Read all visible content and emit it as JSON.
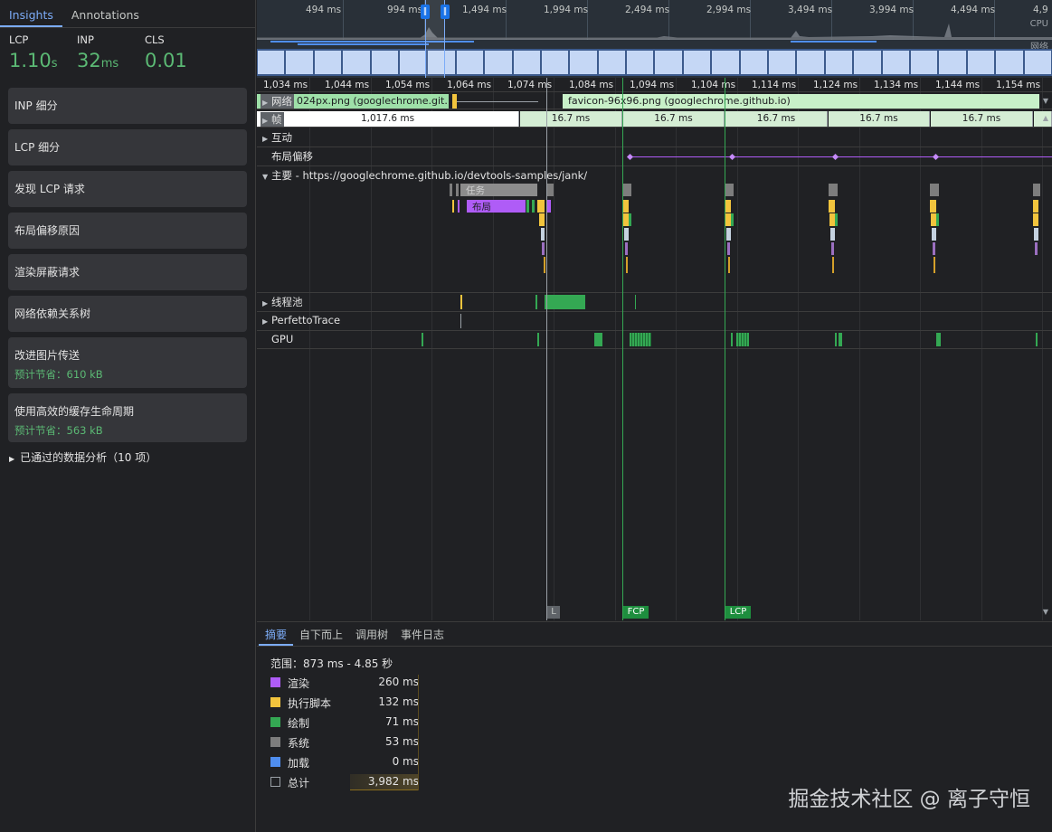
{
  "sidebar": {
    "tabs": [
      {
        "label": "Insights"
      },
      {
        "label": "Annotations"
      }
    ],
    "metrics": [
      {
        "label": "LCP",
        "value": "1.10",
        "unit": "s"
      },
      {
        "label": "INP",
        "value": "32",
        "unit": "ms"
      },
      {
        "label": "CLS",
        "value": "0.01",
        "unit": ""
      }
    ],
    "insights": [
      {
        "title": "INP 细分"
      },
      {
        "title": "LCP 细分"
      },
      {
        "title": "发现 LCP 请求"
      },
      {
        "title": "布局偏移原因"
      },
      {
        "title": "渲染屏蔽请求"
      },
      {
        "title": "网络依赖关系树"
      },
      {
        "title": "改进图片传送",
        "saving": "预计节省：610 kB"
      },
      {
        "title": "使用高效的缓存生命周期",
        "saving": "预计节省：563 kB"
      }
    ],
    "passed": "已通过的数据分析（10 项）"
  },
  "overview": {
    "ticks": [
      "494 ms",
      "994 ms",
      "1,494 ms",
      "1,994 ms",
      "2,494 ms",
      "2,994 ms",
      "3,494 ms",
      "3,994 ms",
      "4,494 ms",
      "4,9"
    ],
    "cpu_label": "CPU",
    "net_label": "网络"
  },
  "timeline": {
    "ruler": [
      "1,034 ms",
      "1,044 ms",
      "1,054 ms",
      "1,064 ms",
      "1,074 ms",
      "1,084 ms",
      "1,094 ms",
      "1,104 ms",
      "1,114 ms",
      "1,124 ms",
      "1,134 ms",
      "1,144 ms",
      "1,154 ms"
    ],
    "network": {
      "label": "网络",
      "request1": "024px.png (googlechrome.git...",
      "request2": "favicon-96x96.png (googlechrome.github.io)"
    },
    "frames": {
      "label": "帧",
      "first": "1,017.6 ms",
      "items": [
        "16.7 ms",
        "16.7 ms",
        "16.7 ms",
        "16.7 ms",
        "16.7 ms"
      ]
    },
    "tracks": {
      "interactions": "互动",
      "layout_shifts": "布局偏移",
      "main": "主要 - https://googlechrome.github.io/devtools-samples/jank/",
      "thread_pool": "线程池",
      "perfetto": "PerfettoTrace",
      "gpu": "GPU"
    },
    "task_label": "任务",
    "layout_label": "布局",
    "markers": {
      "l": "L",
      "fcp": "FCP",
      "lcp": "LCP"
    }
  },
  "bottom": {
    "tabs": [
      {
        "label": "摘要"
      },
      {
        "label": "自下而上"
      },
      {
        "label": "调用树"
      },
      {
        "label": "事件日志"
      }
    ],
    "range": "范围：873 ms - 4.85 秒",
    "categories": [
      {
        "name": "渲染",
        "value": "260 ms",
        "color": "#af5cf7"
      },
      {
        "name": "执行脚本",
        "value": "132 ms",
        "color": "#f2c43d"
      },
      {
        "name": "绘制",
        "value": "71 ms",
        "color": "#34a853"
      },
      {
        "name": "系统",
        "value": "53 ms",
        "color": "#7d7d7d"
      },
      {
        "name": "加载",
        "value": "0 ms",
        "color": "#4f8ef0"
      },
      {
        "name": "总计",
        "value": "3,982 ms",
        "color": "transparent"
      }
    ]
  },
  "watermark": "掘金技术社区 @ 离子守恒"
}
